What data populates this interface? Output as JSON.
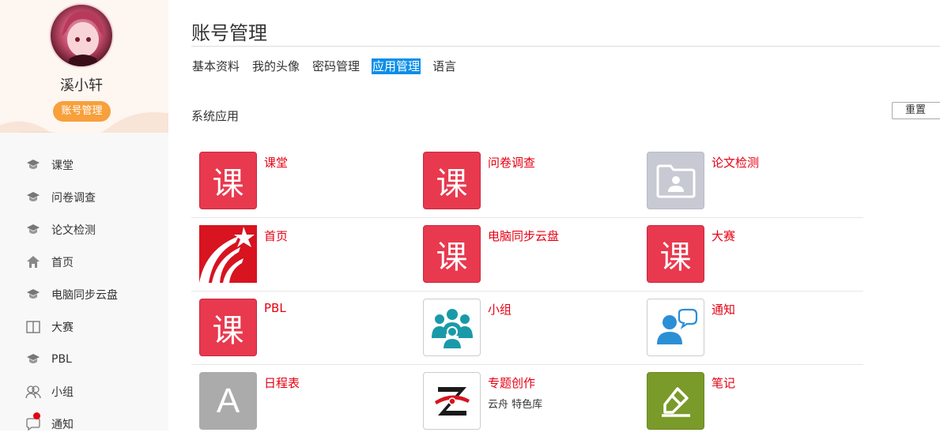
{
  "user": {
    "name": "溪小轩",
    "badge": "账号管理"
  },
  "sidebar": {
    "items": [
      {
        "label": "课堂",
        "icon": "cap-icon"
      },
      {
        "label": "问卷调查",
        "icon": "cap-icon"
      },
      {
        "label": "论文检测",
        "icon": "cap-icon"
      },
      {
        "label": "首页",
        "icon": "home-icon"
      },
      {
        "label": "电脑同步云盘",
        "icon": "cap-icon"
      },
      {
        "label": "大赛",
        "icon": "book-icon"
      },
      {
        "label": "PBL",
        "icon": "cap-icon"
      },
      {
        "label": "小组",
        "icon": "group-icon"
      },
      {
        "label": "通知",
        "icon": "chat-icon"
      }
    ]
  },
  "page": {
    "title": "账号管理"
  },
  "tabs": [
    {
      "label": "基本资料",
      "active": false
    },
    {
      "label": "我的头像",
      "active": false
    },
    {
      "label": "密码管理",
      "active": false
    },
    {
      "label": "应用管理",
      "active": true
    },
    {
      "label": "语言",
      "active": false
    }
  ],
  "section": {
    "label": "系统应用",
    "reset_label": "重置"
  },
  "apps": [
    [
      {
        "name": "课堂",
        "icon_text": "课",
        "sub": ""
      },
      {
        "name": "问卷调查",
        "icon_text": "课",
        "sub": ""
      },
      {
        "name": "论文检测",
        "icon_text": "",
        "sub": ""
      }
    ],
    [
      {
        "name": "首页",
        "icon_text": "",
        "sub": ""
      },
      {
        "name": "电脑同步云盘",
        "icon_text": "课",
        "sub": ""
      },
      {
        "name": "大赛",
        "icon_text": "课",
        "sub": ""
      }
    ],
    [
      {
        "name": "PBL",
        "icon_text": "课",
        "sub": ""
      },
      {
        "name": "小组",
        "icon_text": "",
        "sub": ""
      },
      {
        "name": "通知",
        "icon_text": "",
        "sub": ""
      }
    ],
    [
      {
        "name": "日程表",
        "icon_text": "A",
        "sub": ""
      },
      {
        "name": "专题创作",
        "icon_text": "",
        "sub": "云舟 特色库"
      },
      {
        "name": "笔记",
        "icon_text": "",
        "sub": ""
      }
    ]
  ],
  "colors": {
    "accent": "#0a8ee8",
    "app_name": "#e60012",
    "badge": "#f7a03c",
    "ke_red": "#e8394f"
  }
}
